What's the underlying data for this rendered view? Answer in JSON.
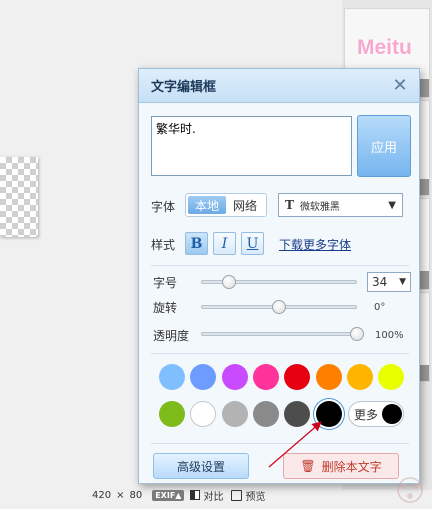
{
  "dialog": {
    "title": "文字编辑框",
    "text_value": "繁华时.",
    "apply_label": "应用",
    "font": {
      "label": "字体",
      "source_options": [
        "本地",
        "网络"
      ],
      "source_selected": "本地",
      "font_name": "微软雅黑"
    },
    "style": {
      "label": "样式",
      "bold": "B",
      "italic": "I",
      "underline": "U",
      "bold_active": true,
      "download_link": "下载更多字体"
    },
    "size": {
      "label": "字号",
      "value": "34"
    },
    "rotation": {
      "label": "旋转",
      "value": "0°",
      "fraction": 0.5
    },
    "opacity": {
      "label": "透明度",
      "value": "100%",
      "fraction": 1.0
    },
    "size_slider_fraction": 0.18,
    "colors_row1": [
      "#7fbfff",
      "#6d9cff",
      "#c94bff",
      "#ff3399",
      "#e60012",
      "#ff8000",
      "#ffb400",
      "#e8ff00"
    ],
    "colors_row2": [
      "#7cbb1a",
      "#ffffff",
      "#b3b3b3",
      "#8a8a8a",
      "#4d4d4d",
      "#000000"
    ],
    "selected_color": "#000000",
    "more_label": "更多",
    "advanced_label": "高级设置",
    "delete_label": "删除本文字"
  },
  "right_panel": {
    "logo_text": "Meitu"
  },
  "bottom_bar": {
    "width": "420",
    "times": "×",
    "height": "80",
    "exif": "EXIF▲",
    "compare": "对比",
    "preview": "预览"
  }
}
